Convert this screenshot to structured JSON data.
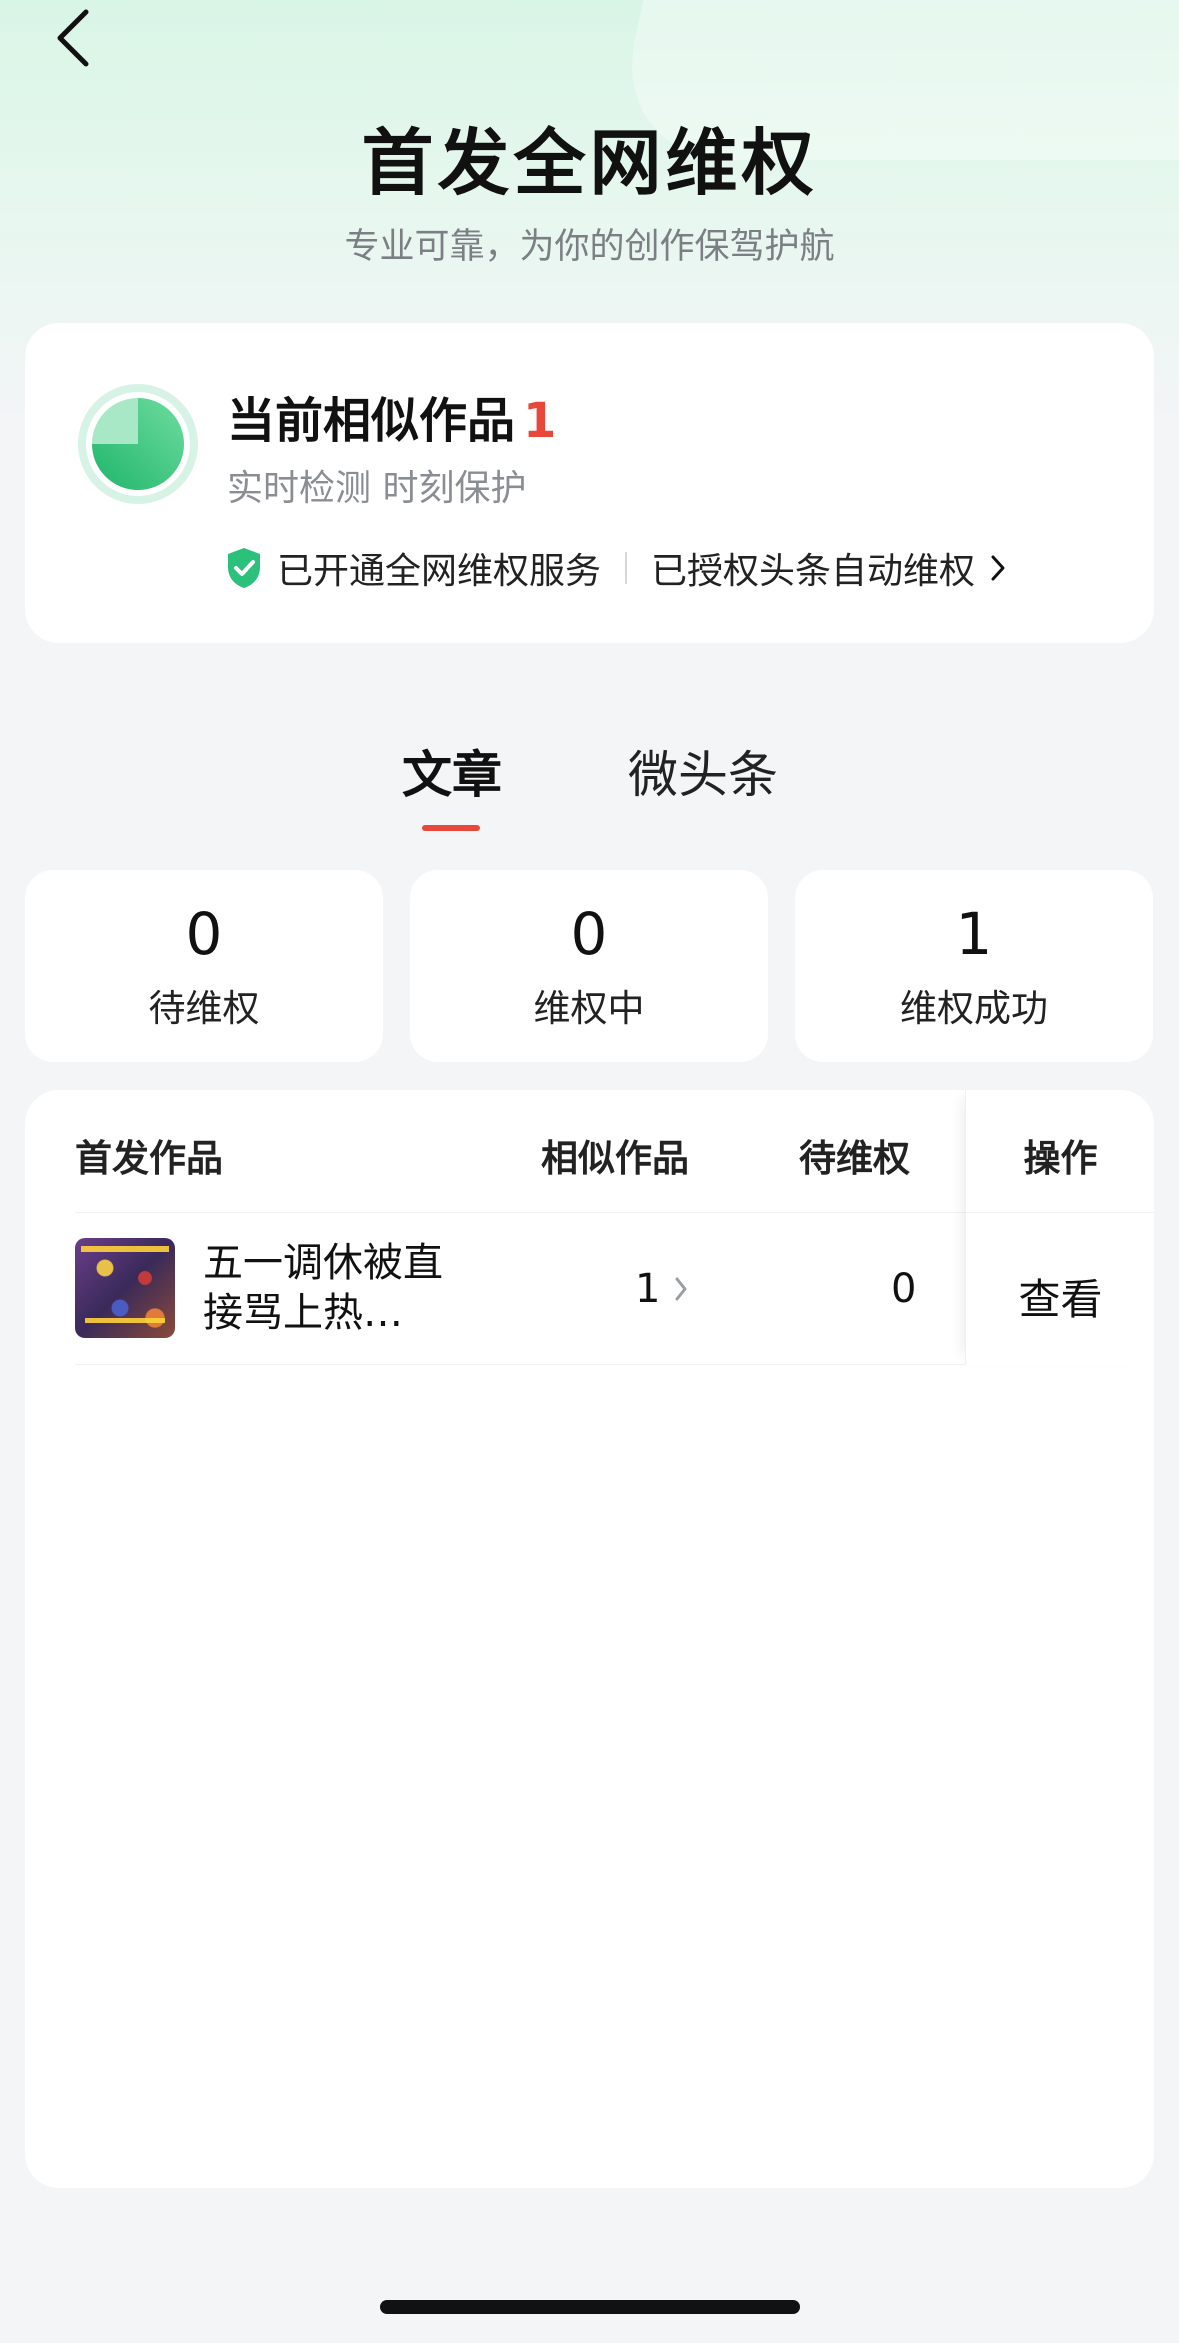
{
  "header": {
    "title": "首发全网维权",
    "subtitle": "专业可靠，为你的创作保驾护航",
    "back_icon": "chevron-left-icon"
  },
  "summary_card": {
    "similar_label": "当前相似作品",
    "similar_count": "1",
    "realtime_text": "实时检测 时刻保护",
    "service_enabled": "已开通全网维权服务",
    "authorized_text": "已授权头条自动维权",
    "accent_color": "#2cc17a",
    "alert_color": "#e8483b"
  },
  "tabs": [
    {
      "label": "文章",
      "active": true
    },
    {
      "label": "微头条",
      "active": false
    }
  ],
  "stats": [
    {
      "value": "0",
      "label": "待维权"
    },
    {
      "value": "0",
      "label": "维权中"
    },
    {
      "value": "1",
      "label": "维权成功"
    }
  ],
  "table": {
    "columns": [
      "首发作品",
      "相似作品",
      "待维权",
      "操作"
    ],
    "rows": [
      {
        "title_line1": "五一调休被直",
        "title_line2": "接骂上热…",
        "similar": "1",
        "pending": "0",
        "action": "查看"
      }
    ]
  }
}
